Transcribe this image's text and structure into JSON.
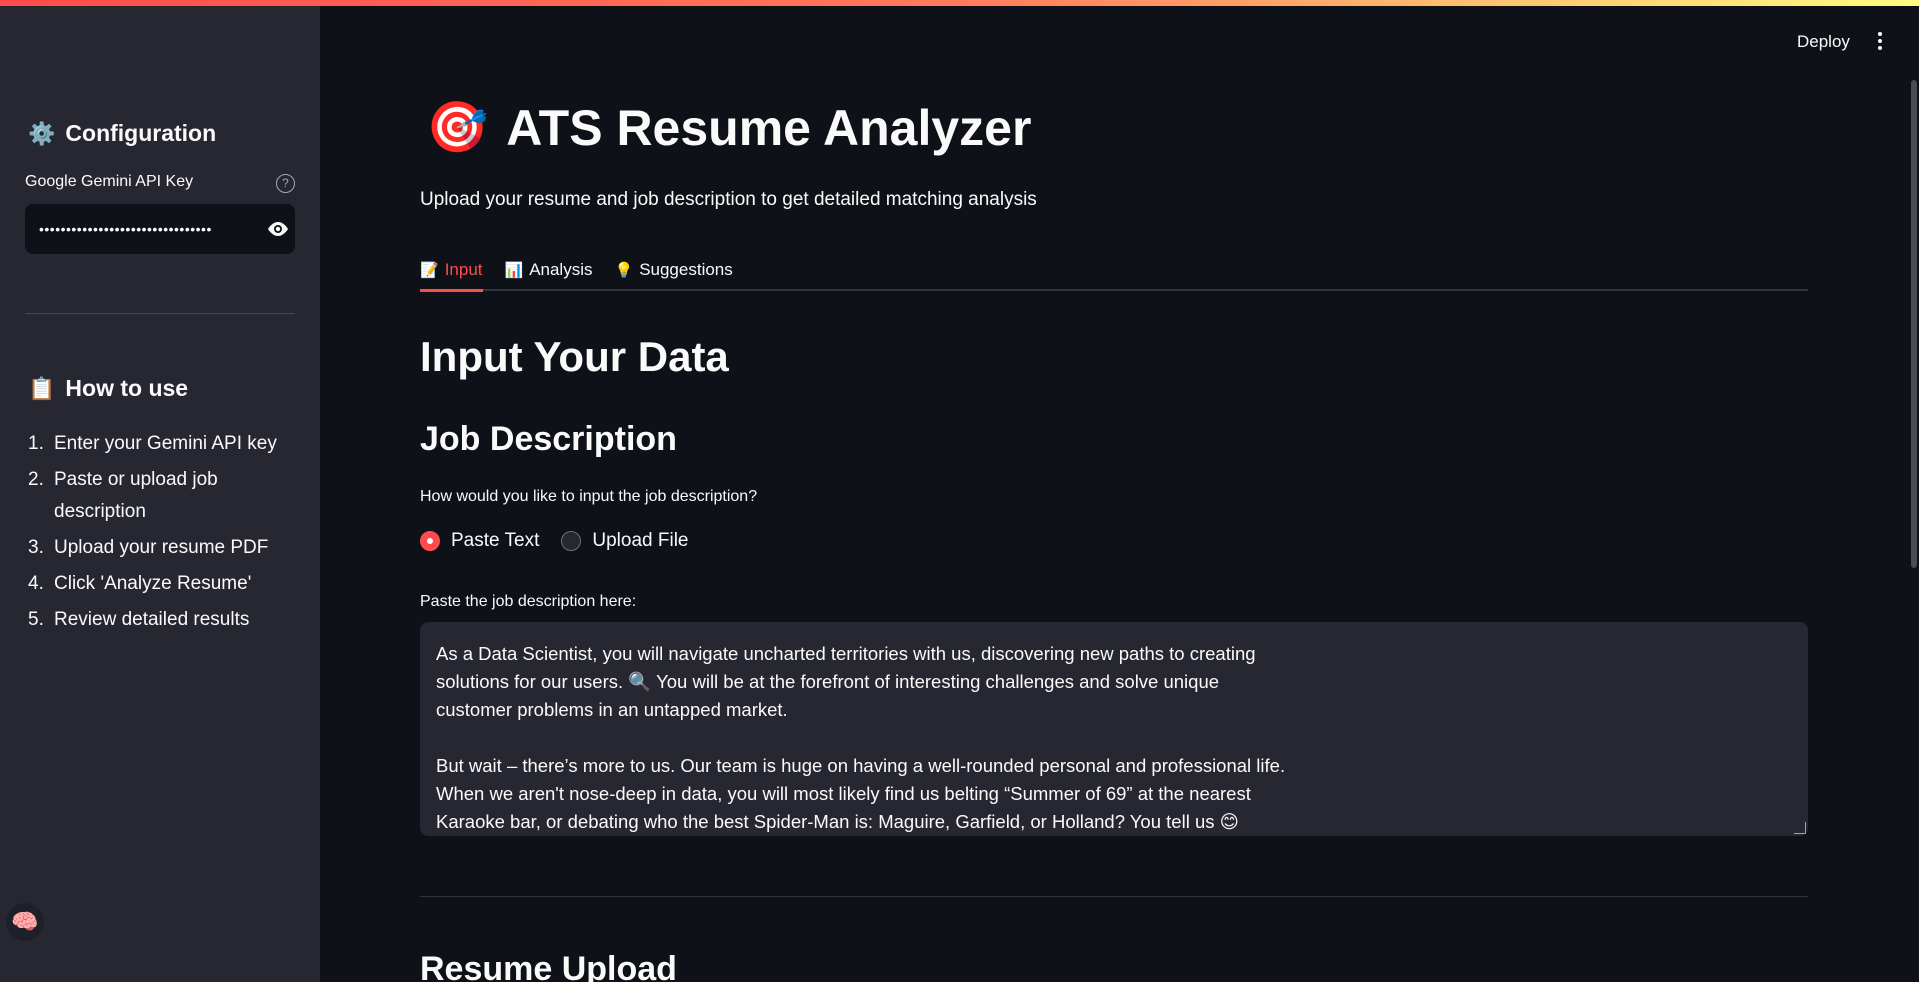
{
  "header": {
    "deploy_label": "Deploy",
    "menu_icon": "kebab-menu-icon"
  },
  "sidebar": {
    "config_title": "Configuration",
    "config_emoji": "⚙️",
    "api_key_label": "Google Gemini API Key",
    "api_key_value": "••••••••••••••••••••••••••••••••",
    "help_symbol": "?",
    "howto_title": "How to use",
    "howto_emoji": "📋",
    "howto_items": [
      {
        "num": "1.",
        "text": "Enter your Gemini API key"
      },
      {
        "num": "2.",
        "text": "Paste or upload job description"
      },
      {
        "num": "3.",
        "text": "Upload your resume PDF"
      },
      {
        "num": "4.",
        "text": "Click 'Analyze Resume'"
      },
      {
        "num": "5.",
        "text": "Review detailed results"
      }
    ],
    "brain_emoji": "🧠"
  },
  "main": {
    "title_emoji": "🎯",
    "title": "ATS Resume Analyzer",
    "subtitle": "Upload your resume and job description to get detailed matching analysis",
    "tabs": [
      {
        "emoji": "📝",
        "label": "Input",
        "active": true
      },
      {
        "emoji": "📊",
        "label": "Analysis",
        "active": false
      },
      {
        "emoji": "💡",
        "label": "Suggestions",
        "active": false
      }
    ],
    "section_title": "Input Your Data",
    "job_desc_title": "Job Description",
    "input_question": "How would you like to input the job description?",
    "radio_options": [
      {
        "label": "Paste Text",
        "checked": true
      },
      {
        "label": "Upload File",
        "checked": false
      }
    ],
    "paste_label": "Paste the job description here:",
    "job_text": "As a Data Scientist, you will navigate uncharted territories with us, discovering new paths to creating\nsolutions for our users. 🔍  You will be at the forefront of interesting challenges and solve unique\ncustomer problems in an untapped market.\n\nBut wait – there’s more to us. Our team is huge on having a well-rounded personal and professional life.\nWhen we aren't nose-deep in data, you will most likely find us belting “Summer of 69” at the nearest\nKaraoke bar, or debating who the best Spider-Man is: Maguire, Garfield, or Holland? You tell us 😊",
    "resume_title": "Resume Upload"
  },
  "colors": {
    "accent": "#ff4b4b",
    "background": "#0e1117",
    "sidebar": "#262730"
  }
}
